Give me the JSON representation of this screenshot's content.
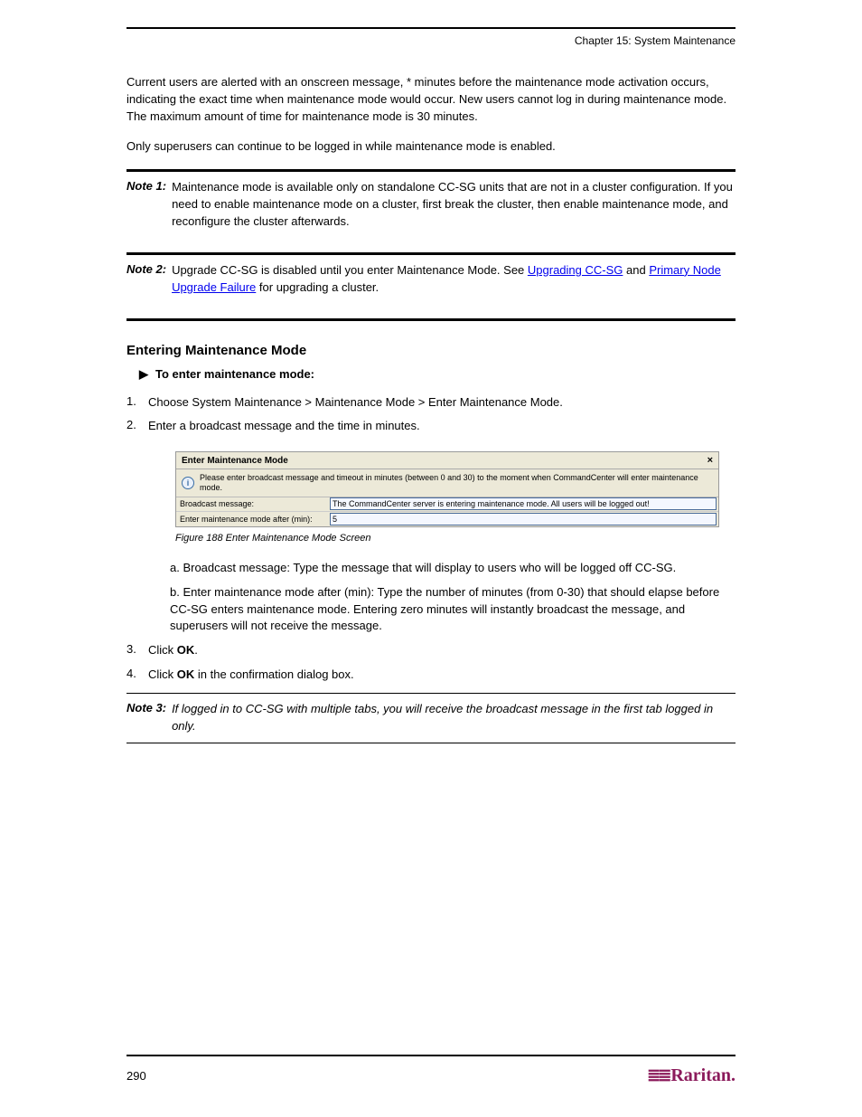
{
  "header": {
    "chapter_line": "Chapter 15: System Maintenance"
  },
  "intro": {
    "p1": "Current users are alerted with an onscreen message, * minutes before the maintenance mode activation occurs, indicating the exact time when maintenance mode would occur. New users cannot log in during maintenance mode. The maximum amount of time for maintenance mode is 30 minutes.",
    "p2": "Only superusers can continue to be logged in while maintenance mode is enabled."
  },
  "note1": {
    "label": "Note 1:",
    "body": "Maintenance mode is available only on standalone CC-SG units that are not in a cluster configuration. If you need to enable maintenance mode on a cluster, first break the cluster, then enable maintenance mode, and reconfigure the cluster afterwards."
  },
  "note2": {
    "label": "Note 2:",
    "body_prefix": "Upgrade CC-SG is disabled until you enter Maintenance Mode. See ",
    "link1": "Upgrading CC-SG",
    "body_mid": " and ",
    "link2": "Primary Node Upgrade Failure",
    "body_suffix": " for upgrading a cluster."
  },
  "section": {
    "title": "Entering Maintenance Mode",
    "bullet_label": "To enter maintenance mode:",
    "step1": "Choose System Maintenance > Maintenance Mode > Enter Maintenance Mode.",
    "step2": "Enter a broadcast message and the time in minutes."
  },
  "figure": {
    "titlebar": "Enter Maintenance Mode",
    "close_glyph": "×",
    "info_icon_glyph": "i",
    "info_text": "Please enter broadcast message and timeout in minutes (between 0 and 30) to the moment when CommandCenter will enter maintenance mode.",
    "row1_label": "Broadcast message:",
    "row1_value": "The CommandCenter server is entering maintenance mode. All users will be logged out!",
    "row2_label": "Enter maintenance mode after (min):",
    "row2_value": "5",
    "caption": "Figure 188 Enter Maintenance Mode Screen"
  },
  "after_figure": {
    "li_a": "a. Broadcast message: Type the message that will display to users who will be logged off CC-SG.",
    "li_b": "b. Enter maintenance mode after (min): Type the number of minutes (from 0-30) that should elapse before CC-SG enters maintenance mode. Entering zero minutes will instantly broadcast the message, and superusers will not receive the message.",
    "step3_pre": "Click ",
    "step3_strong": "OK",
    "step3_post": ".",
    "step4_pre": "Click ",
    "step4_strong": "OK",
    "step4_post": " in the confirmation dialog box."
  },
  "note3": {
    "label": "Note 3:",
    "body": "If logged in to CC-SG with multiple tabs, you will receive the broadcast message in the first tab logged in only."
  },
  "footer": {
    "page_number": "290",
    "brand_glyph": "≣≣",
    "brand_text": "Raritan."
  }
}
